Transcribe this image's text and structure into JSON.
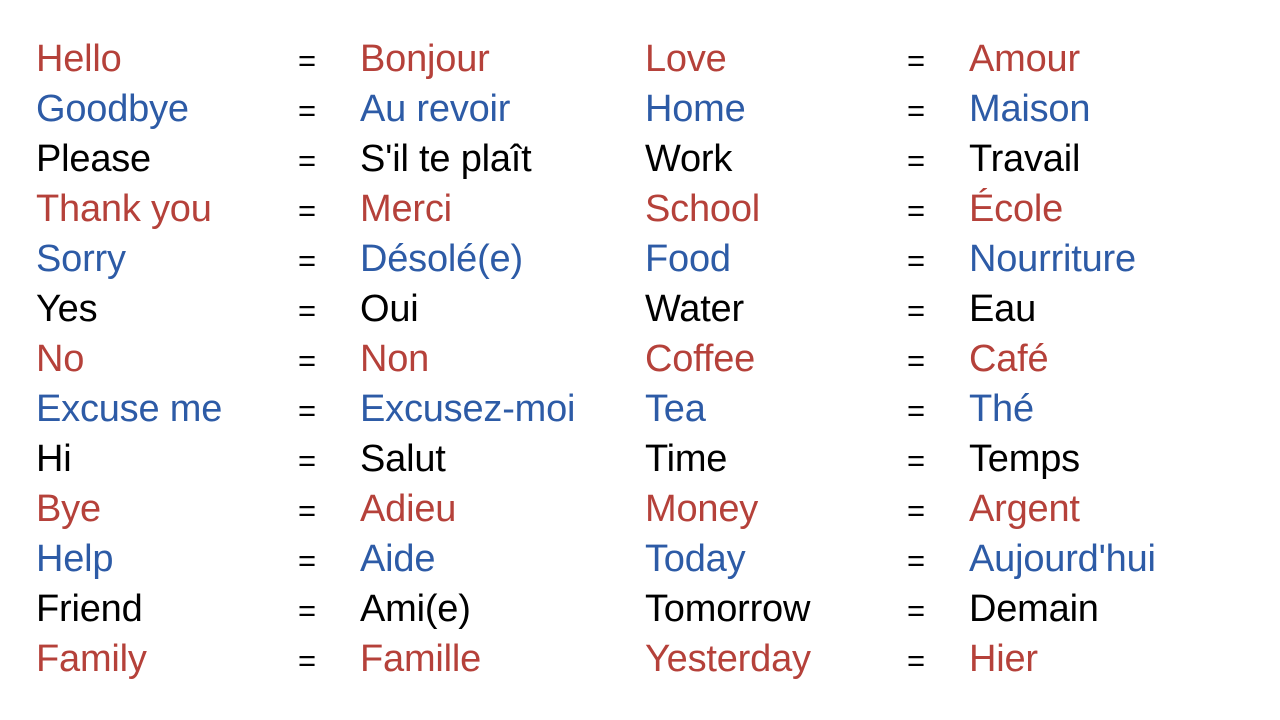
{
  "document": {
    "type": "vocabulary-table",
    "separator": "=",
    "colors": {
      "red": "#b5413a",
      "blue": "#2d5ba6",
      "black": "#000000",
      "background": "#ffffff"
    },
    "color_cycle": [
      "red",
      "blue",
      "black"
    ]
  },
  "columns": [
    {
      "name": "left-column",
      "rows": [
        {
          "source": "Hello",
          "target": "Bonjour",
          "color": "red"
        },
        {
          "source": "Goodbye",
          "target": "Au revoir",
          "color": "blue"
        },
        {
          "source": "Please",
          "target": "S'il te plaît",
          "color": "black"
        },
        {
          "source": "Thank you",
          "target": "Merci",
          "color": "red"
        },
        {
          "source": "Sorry",
          "target": "Désolé(e)",
          "color": "blue"
        },
        {
          "source": "Yes",
          "target": "Oui",
          "color": "black"
        },
        {
          "source": "No",
          "target": "Non",
          "color": "red"
        },
        {
          "source": "Excuse me",
          "target": "Excusez-moi",
          "color": "blue"
        },
        {
          "source": "Hi",
          "target": "Salut",
          "color": "black"
        },
        {
          "source": "Bye",
          "target": "Adieu",
          "color": "red"
        },
        {
          "source": "Help",
          "target": "Aide",
          "color": "blue"
        },
        {
          "source": "Friend",
          "target": "Ami(e)",
          "color": "black"
        },
        {
          "source": "Family",
          "target": "Famille",
          "color": "red"
        }
      ]
    },
    {
      "name": "right-column",
      "rows": [
        {
          "source": "Love",
          "target": "Amour",
          "color": "red"
        },
        {
          "source": "Home",
          "target": "Maison",
          "color": "blue"
        },
        {
          "source": "Work",
          "target": "Travail",
          "color": "black"
        },
        {
          "source": "School",
          "target": "École",
          "color": "red"
        },
        {
          "source": "Food",
          "target": "Nourriture",
          "color": "blue"
        },
        {
          "source": "Water",
          "target": "Eau",
          "color": "black"
        },
        {
          "source": "Coffee",
          "target": "Café",
          "color": "red"
        },
        {
          "source": "Tea",
          "target": "Thé",
          "color": "blue"
        },
        {
          "source": "Time",
          "target": "Temps",
          "color": "black"
        },
        {
          "source": "Money",
          "target": "Argent",
          "color": "red"
        },
        {
          "source": "Today",
          "target": "Aujourd'hui",
          "color": "blue"
        },
        {
          "source": "Tomorrow",
          "target": "Demain",
          "color": "black"
        },
        {
          "source": "Yesterday",
          "target": "Hier",
          "color": "red"
        }
      ]
    }
  ]
}
